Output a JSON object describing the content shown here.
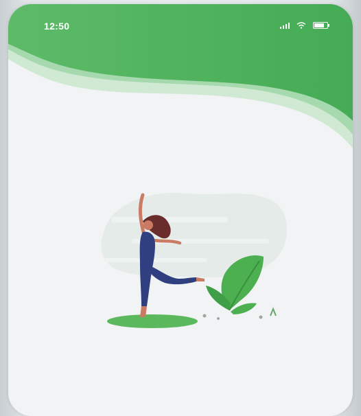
{
  "status_bar": {
    "time": "12:50",
    "icons": [
      "signal-icon",
      "wifi-icon",
      "battery-icon"
    ]
  },
  "header": {
    "colors": {
      "primary": "#4fb35d",
      "light": "#9fd6a8",
      "background": "#f1f3f4"
    }
  },
  "illustration": {
    "description_icon": "dancing-woman-with-plant-illustration",
    "colors": {
      "figure": "#2f3f80",
      "hair": "#6a2d2d",
      "ground": "#5cb85c",
      "leaf": "#4caf50"
    }
  },
  "headline": {
    "text": ""
  }
}
